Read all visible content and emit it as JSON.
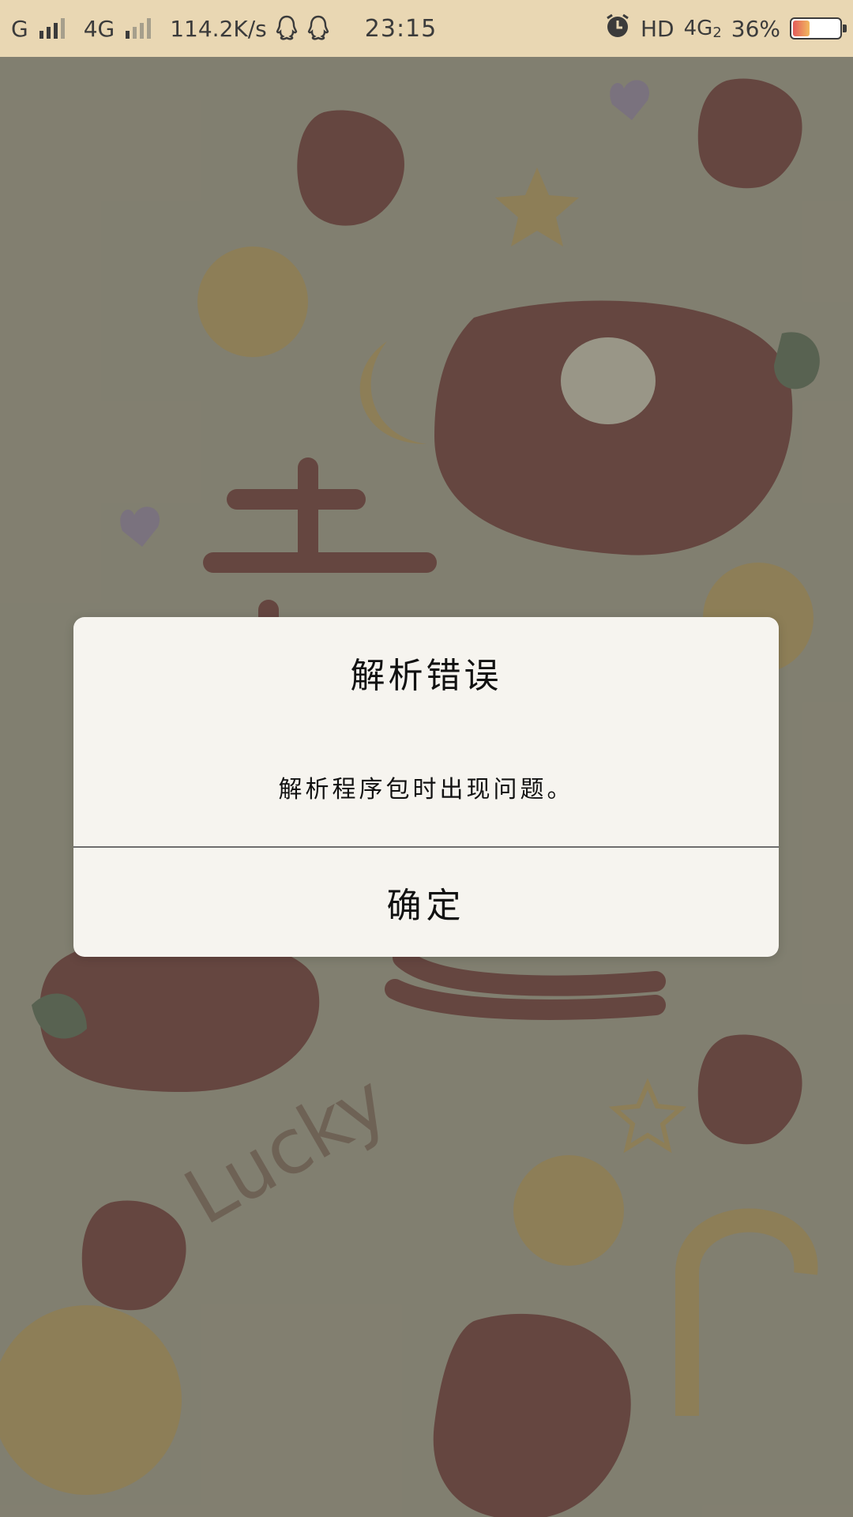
{
  "status_bar": {
    "carrier1": "G",
    "carrier2": "4G",
    "net_speed": "114.2K/s",
    "time": "23:15",
    "hd_label": "HD",
    "net_label": "4G",
    "sim_index": "2",
    "battery_percent_text": "36%",
    "battery_level": 0.36,
    "icons": [
      "signal-icon",
      "qq-icon",
      "alarm-icon",
      "battery-icon"
    ]
  },
  "wallpaper": {
    "decor_text": "Lucky"
  },
  "dialog": {
    "title": "解析错误",
    "message": "解析程序包时出现问题。",
    "ok_label": "确定"
  }
}
